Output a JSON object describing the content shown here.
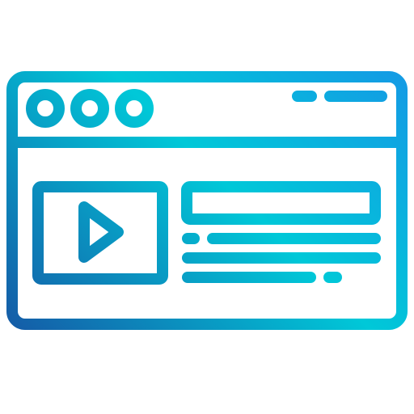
{
  "icon": {
    "name": "browser-video-icon",
    "colors": {
      "gradient_start": "#1a3f9a",
      "gradient_mid": "#00c8d8",
      "gradient_end": "#1a8de8"
    },
    "window_controls": [
      "circle-button",
      "circle-button",
      "circle-button"
    ],
    "media": {
      "type": "video",
      "play_icon": "play-icon"
    }
  }
}
